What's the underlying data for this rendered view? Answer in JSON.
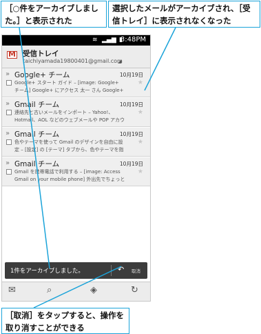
{
  "callouts": {
    "top_left": "［○件をアーカイブしました。］と表示された",
    "top_right": "選択したメールがアーカイブされ、［受信トレイ］に表示されなくなった",
    "bottom": "［取消］をタップすると、操作を取り消すことができる"
  },
  "statusbar": {
    "time": "3:48PM"
  },
  "header": {
    "title": "受信トレイ",
    "account": "taichiyamada19800401@gmail.com"
  },
  "emails": [
    {
      "sender": "Google+ チーム",
      "date": "10月19日",
      "snippet1": "Google+ スタート ガイド – [image: Google+",
      "snippet2": "チーム] Google+ にアクセス 太一 さん Google+"
    },
    {
      "sender": "Gmail チーム",
      "date": "10月19日",
      "snippet1": "連絡先と古いメールをインポート – Yahoo!、",
      "snippet2": "Hotmail、AOL などのウェブメールや POP アカウ"
    },
    {
      "sender": "Gmail チーム",
      "date": "10月19日",
      "snippet1": "色やテーマを使って Gmail のデザインを自由に設",
      "snippet2": "定 – [設定] の [テーマ] タブから、色やテーマを指"
    },
    {
      "sender": "Gmail チーム",
      "date": "10月19日",
      "snippet1": "Gmail を携帯電話で利用する – [image: Access",
      "snippet2": "Gmail on your mobile phone] 外出先でちょっと"
    }
  ],
  "toast": {
    "message": "1件をアーカイブしました。",
    "undo_label": "取消"
  },
  "icons": {
    "compose": "compose-icon",
    "search": "search-icon",
    "labels": "labels-icon",
    "refresh": "refresh-icon",
    "undo": "undo-icon"
  },
  "colors": {
    "callout_border": "#1aa3d9",
    "gmail_red": "#c53929",
    "toast_bg": "#3c3c3c"
  }
}
